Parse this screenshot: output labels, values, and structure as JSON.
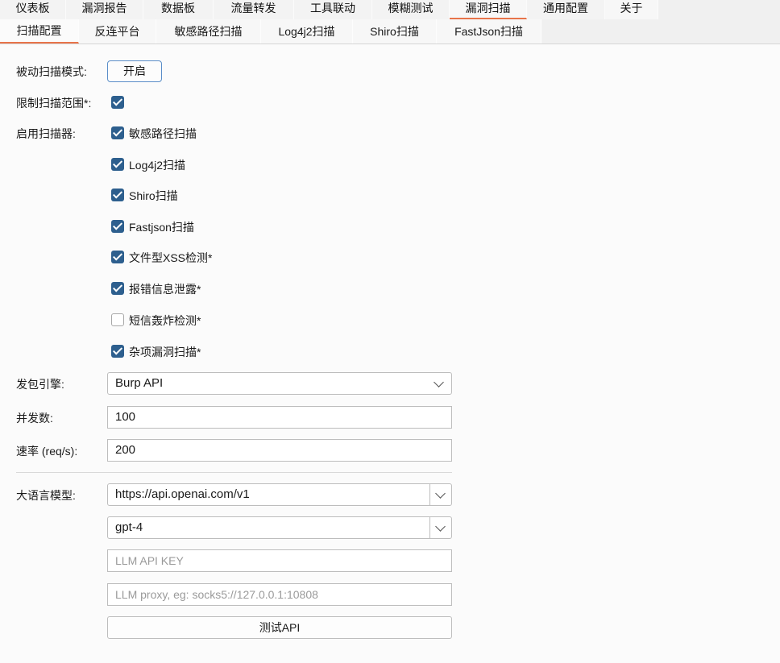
{
  "main_tabs": [
    "仪表板",
    "漏洞报告",
    "数据板",
    "流量转发",
    "工具联动",
    "模糊测试",
    "漏洞扫描",
    "通用配置",
    "关于"
  ],
  "sub_tabs": [
    "扫描配置",
    "反连平台",
    "敏感路径扫描",
    "Log4j2扫描",
    "Shiro扫描",
    "FastJson扫描"
  ],
  "form": {
    "passive_label": "被动扫描模式:",
    "passive_button": "开启",
    "limit_label": "限制扫描范围*:",
    "scanners_label": "启用扫描器:",
    "scanners": [
      {
        "label": "敏感路径扫描",
        "checked": true
      },
      {
        "label": "Log4j2扫描",
        "checked": true
      },
      {
        "label": "Shiro扫描",
        "checked": true
      },
      {
        "label": "Fastjson扫描",
        "checked": true
      },
      {
        "label": "文件型XSS检测*",
        "checked": true
      },
      {
        "label": "报错信息泄露*",
        "checked": true
      },
      {
        "label": "短信轰炸检测*",
        "checked": false
      },
      {
        "label": "杂项漏洞扫描*",
        "checked": true
      }
    ],
    "engine_label": "发包引擎:",
    "engine_value": "Burp API",
    "concurrency_label": "并发数:",
    "concurrency_value": "100",
    "rate_label": "速率 (req/s):",
    "rate_value": "200",
    "llm_label": "大语言模型:",
    "llm_url": "https://api.openai.com/v1",
    "llm_model": "gpt-4",
    "llm_key_placeholder": "LLM API KEY",
    "llm_proxy_placeholder": "LLM proxy, eg: socks5://127.0.0.1:10808",
    "test_button": "测试API"
  }
}
